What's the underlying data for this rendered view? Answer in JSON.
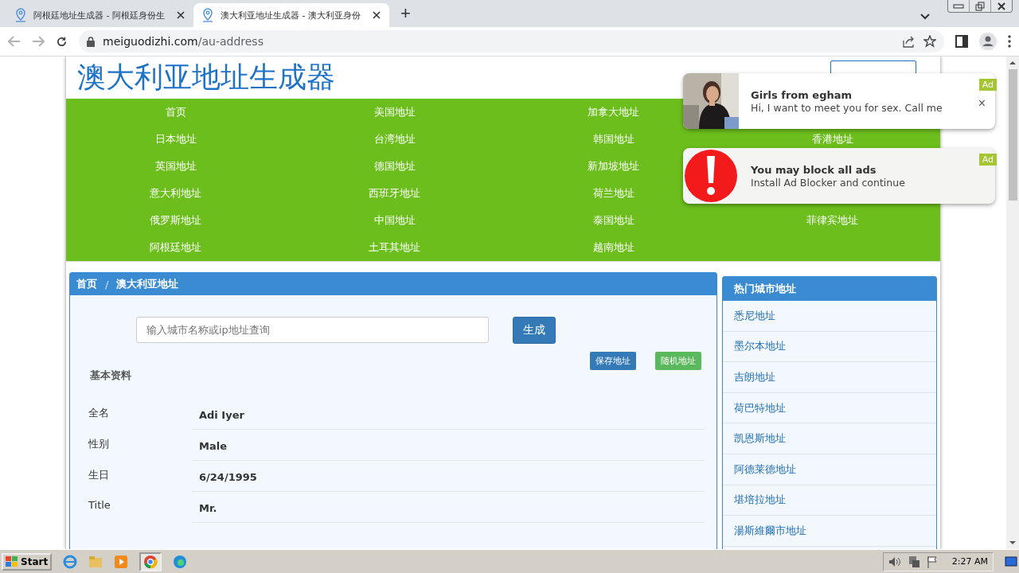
{
  "browser": {
    "tabs": [
      {
        "title": "阿根廷地址生成器 - 阿根廷身份生",
        "selected": false
      },
      {
        "title": "澳大利亚地址生成器 - 澳大利亚身份",
        "selected": true
      }
    ],
    "new_tab": "+",
    "url_host": "meiguodizhi.com",
    "url_path": "/au-address"
  },
  "site": {
    "title": "澳大利亚地址生成器",
    "nav_rows": [
      [
        "首页",
        "美国地址",
        "加拿大地址"
      ],
      [
        "日本地址",
        "台湾地址",
        "韩国地址",
        "香港地址"
      ],
      [
        "英国地址",
        "德国地址",
        "新加坡地址"
      ],
      [
        "意大利地址",
        "西班牙地址",
        "荷兰地址"
      ],
      [
        "俄罗斯地址",
        "中国地址",
        "泰国地址",
        "菲律宾地址"
      ],
      [
        "阿根廷地址",
        "土耳其地址",
        "越南地址"
      ]
    ],
    "breadcrumb": [
      "首页",
      "澳大利亚地址"
    ],
    "breadcrumb_separator": "/",
    "search": {
      "placeholder": "输入城市名称或ip地址查询"
    },
    "generate_button": "生成",
    "save_button": "保存地址",
    "random_button": "随机地址",
    "section": "基本资料",
    "fields": [
      {
        "label": "全名",
        "value": "Adi Iyer"
      },
      {
        "label": "性别",
        "value": "Male"
      },
      {
        "label": "生日",
        "value": "6/24/1995"
      },
      {
        "label": "Title",
        "value": "Mr."
      }
    ]
  },
  "sidebar": {
    "title": "热门城市地址",
    "items": [
      "悉尼地址",
      "墨尔本地址",
      "吉朗地址",
      "荷巴特地址",
      "凯恩斯地址",
      "阿德莱德地址",
      "堪培拉地址",
      "湯斯維爾市地址"
    ]
  },
  "ads": [
    {
      "title": "Girls from  egham",
      "text": "Hi, I want to meet you for sex. Call me",
      "badge": "Ad",
      "close": "×"
    },
    {
      "kind": "alert",
      "title": "You may block all ads",
      "text": "Install Ad Blocker and continue",
      "badge": "Ad"
    }
  ],
  "taskbar": {
    "start": "Start",
    "time": "2:27 AM"
  }
}
